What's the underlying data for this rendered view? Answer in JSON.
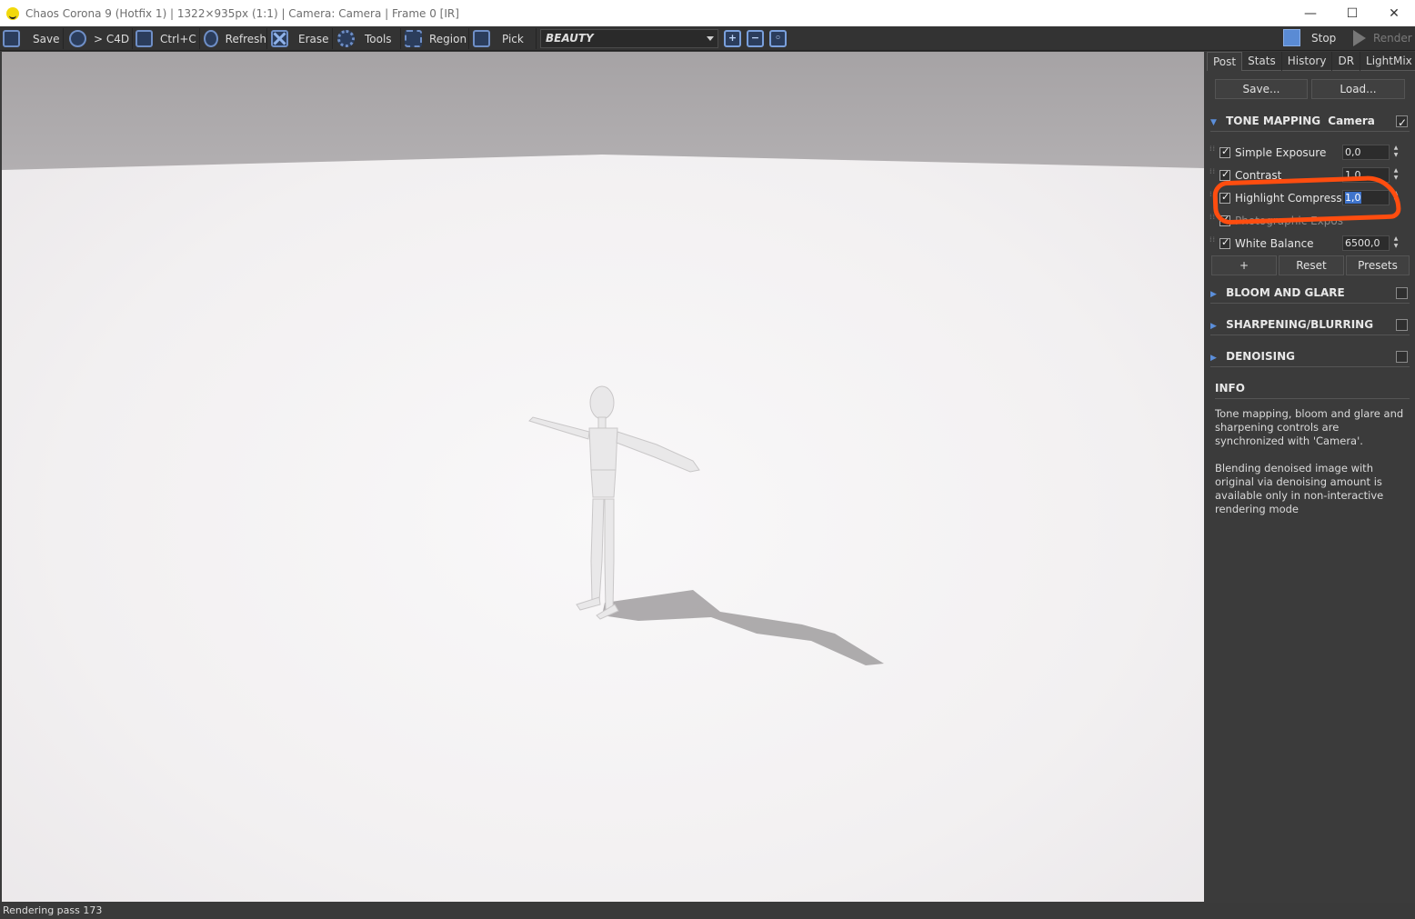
{
  "window": {
    "title": "Chaos Corona 9 (Hotfix 1) | 1322×935px (1:1) | Camera: Camera | Frame 0 [IR]",
    "minimize": "—",
    "maximize": "☐",
    "close": "✕"
  },
  "toolbar": {
    "save": "Save",
    "c4d": "> C4D",
    "ctrlc": "Ctrl+C",
    "refresh": "Refresh",
    "erase": "Erase",
    "tools": "Tools",
    "region": "Region",
    "pick": "Pick",
    "channel": "BEAUTY",
    "stop": "Stop",
    "render": "Render"
  },
  "status": {
    "text": "Rendering pass 173"
  },
  "panel": {
    "tabs": [
      "Post",
      "Stats",
      "History",
      "DR",
      "LightMix"
    ],
    "save_btn": "Save...",
    "load_btn": "Load...",
    "tone_mapping": {
      "title": "TONE MAPPING",
      "source": "Camera",
      "rows": [
        {
          "label": "Simple Exposure",
          "value": "0,0"
        },
        {
          "label": "Contrast",
          "value": "1,0"
        },
        {
          "label": "Highlight Compression",
          "value": "1,0"
        },
        {
          "label": "Photographic Exposure",
          "value": ""
        },
        {
          "label": "White Balance",
          "value": "6500,0"
        }
      ],
      "add_btn": "+",
      "reset_btn": "Reset",
      "presets_btn": "Presets"
    },
    "sections": [
      "BLOOM AND GLARE",
      "SHARPENING/BLURRING",
      "DENOISING"
    ],
    "info": {
      "title": "INFO",
      "text1": "Tone mapping, bloom and glare and sharpening controls are synchronized with 'Camera'.",
      "text2": "Blending denoised image with original via denoising amount is available only in non-interactive rendering mode"
    }
  },
  "colors": {
    "accent": "#5a8bd4",
    "annotation": "#ff4d0f"
  }
}
